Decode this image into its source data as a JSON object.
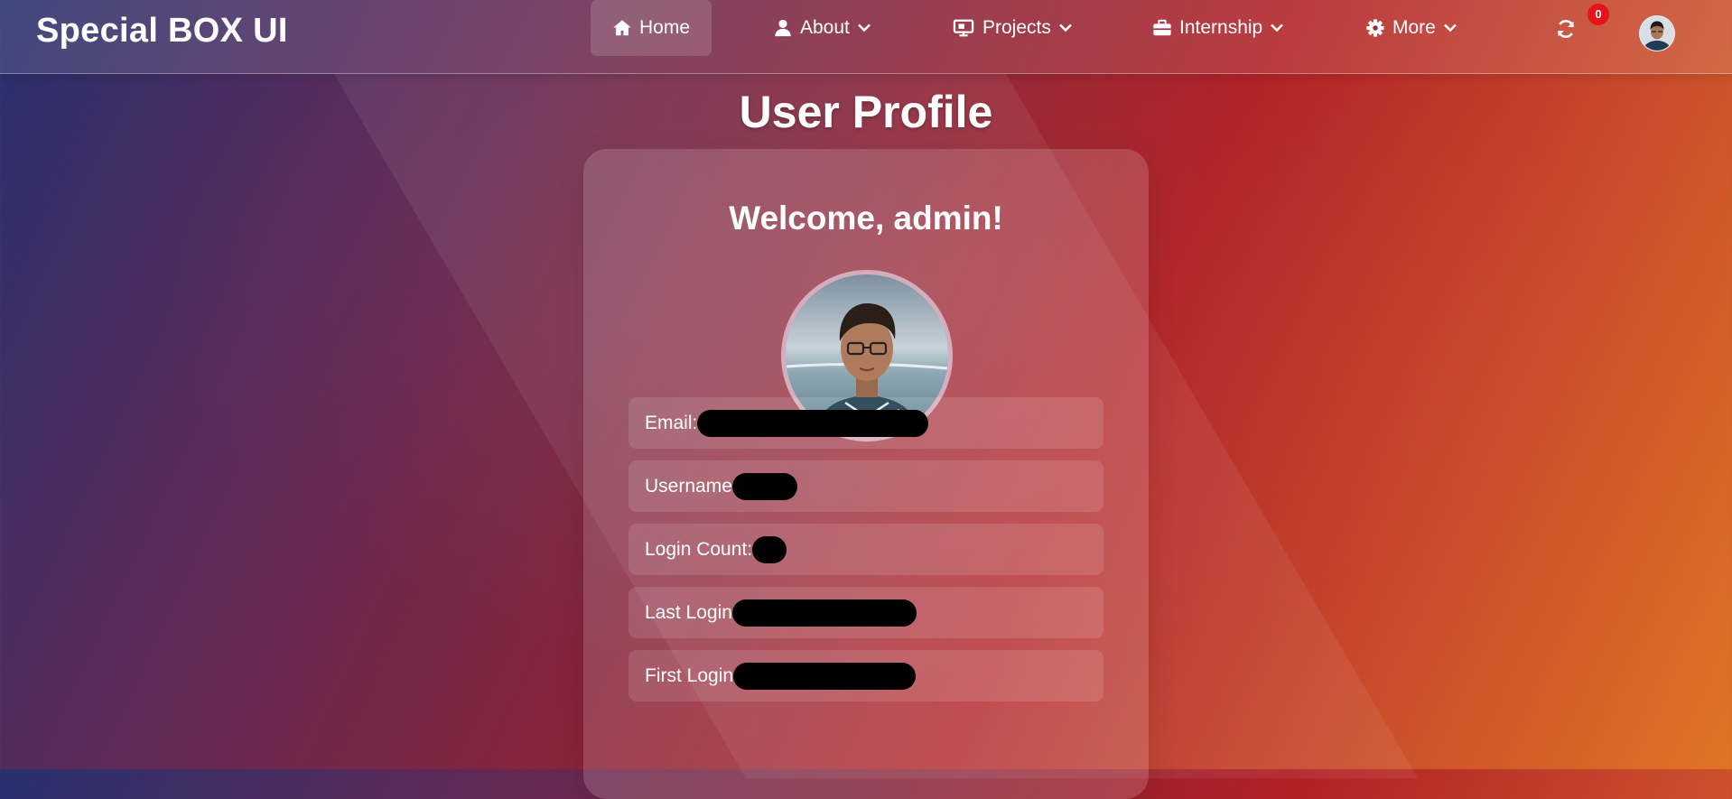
{
  "brand": "Special BOX UI",
  "nav": {
    "home": "Home",
    "about": "About",
    "projects": "Projects",
    "internship": "Internship",
    "more": "More"
  },
  "notifications": {
    "count": "0"
  },
  "page": {
    "title": "User Profile",
    "welcome": "Welcome, admin!"
  },
  "profile_fields": {
    "email": "Email:",
    "username": "Username",
    "login_count": "Login Count:",
    "last_login": "Last Login",
    "first_login": "First Login"
  },
  "colors": {
    "badge": "#e3141b",
    "gradient_start": "#27306e",
    "gradient_end": "#df7424"
  },
  "icons": {
    "home": "home-icon",
    "about": "user-icon",
    "projects": "presentation-icon",
    "internship": "briefcase-icon",
    "more": "gear-icon",
    "refresh": "refresh-icon"
  }
}
